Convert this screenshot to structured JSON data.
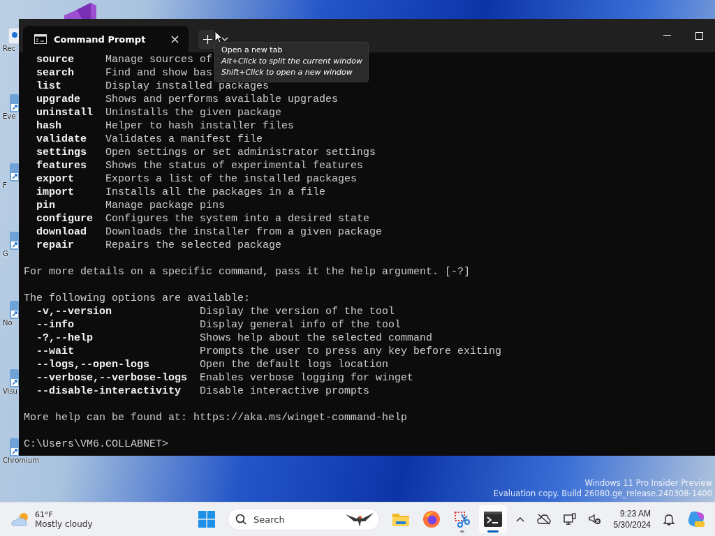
{
  "desktop_icons": [
    {
      "kind": "bin",
      "label": "Rec"
    },
    {
      "kind": "shortcut",
      "label": "Eve"
    },
    {
      "kind": "shortcut",
      "label": "F"
    },
    {
      "kind": "shortcut",
      "label": "G"
    },
    {
      "kind": "shortcut",
      "label": "No"
    },
    {
      "kind": "shortcut",
      "label": "Visu"
    },
    {
      "kind": "shortcut",
      "label": "Chromium"
    }
  ],
  "window": {
    "tabs": [
      {
        "title": "Command Prompt",
        "selected": true
      }
    ],
    "tooltip": {
      "title": "Open a new tab",
      "hints": [
        "Alt+Click to split the current window",
        "Shift+Click to open a new window"
      ]
    },
    "terminal": {
      "commands": [
        {
          "name": "source",
          "description": "Manage sources of"
        },
        {
          "name": "search",
          "description": "Find and show bas"
        },
        {
          "name": "list",
          "description": "Display installed packages"
        },
        {
          "name": "upgrade",
          "description": "Shows and performs available upgrades"
        },
        {
          "name": "uninstall",
          "description": "Uninstalls the given package"
        },
        {
          "name": "hash",
          "description": "Helper to hash installer files"
        },
        {
          "name": "validate",
          "description": "Validates a manifest file"
        },
        {
          "name": "settings",
          "description": "Open settings or set administrator settings"
        },
        {
          "name": "features",
          "description": "Shows the status of experimental features"
        },
        {
          "name": "export",
          "description": "Exports a list of the installed packages"
        },
        {
          "name": "import",
          "description": "Installs all the packages in a file"
        },
        {
          "name": "pin",
          "description": "Manage package pins"
        },
        {
          "name": "configure",
          "description": "Configures the system into a desired state"
        },
        {
          "name": "download",
          "description": "Downloads the installer from a given package"
        },
        {
          "name": "repair",
          "description": "Repairs the selected package"
        }
      ],
      "details_note": "For more details on a specific command, pass it the help argument. [-?]",
      "options_heading": "The following options are available:",
      "options": [
        {
          "flag": "-v,--version",
          "description": "Display the version of the tool"
        },
        {
          "flag": "--info",
          "description": "Display general info of the tool"
        },
        {
          "flag": "-?,--help",
          "description": "Shows help about the selected command"
        },
        {
          "flag": "--wait",
          "description": "Prompts the user to press any key before exiting"
        },
        {
          "flag": "--logs,--open-logs",
          "description": "Open the default logs location"
        },
        {
          "flag": "--verbose,--verbose-logs",
          "description": "Enables verbose logging for winget"
        },
        {
          "flag": "--disable-interactivity",
          "description": "Disable interactive prompts"
        }
      ],
      "help_note": "More help can be found at: https://aka.ms/winget-command-help",
      "prompt": "C:\\Users\\VM6.COLLABNET>"
    }
  },
  "watermark": [
    "Windows 11 Pro Insider Preview",
    "Evaluation copy. Build 26080.ge_release.240308-1400"
  ],
  "taskbar": {
    "weather": {
      "temperature": "61°F",
      "condition": "Mostly cloudy"
    },
    "search": {
      "placeholder": "Search"
    },
    "apps": [
      {
        "kind": "folder",
        "running": false,
        "selected": false
      },
      {
        "kind": "browser",
        "running": false,
        "selected": false
      },
      {
        "kind": "snip",
        "running": true,
        "selected": false
      },
      {
        "kind": "terminal",
        "running": true,
        "selected": true
      }
    ],
    "clock": {
      "time": "9:23 AM",
      "date": "5/30/2024"
    }
  }
}
